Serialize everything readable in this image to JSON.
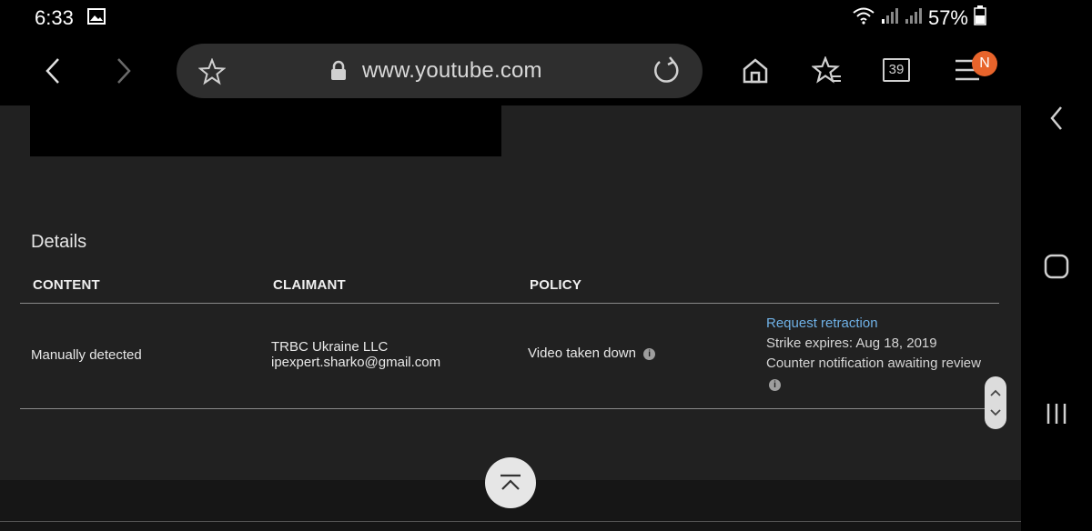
{
  "status_bar": {
    "time": "6:33",
    "battery": "57%"
  },
  "browser": {
    "url": "www.youtube.com",
    "tab_count": "39",
    "notification_badge": "N"
  },
  "details": {
    "heading": "Details",
    "columns": [
      "CONTENT",
      "CLAIMANT",
      "POLICY"
    ],
    "row": {
      "content": "Manually detected",
      "claimant_name": "TRBC Ukraine LLC",
      "claimant_email": "ipexpert.sharko@gmail.com",
      "policy": "Video taken down",
      "action_link": "Request retraction",
      "strike_expires": "Strike expires: Aug 18, 2019",
      "counter_status": "Counter notification awaiting review"
    }
  },
  "colors": {
    "page_bg": "#212121",
    "link": "#6fb1e6",
    "badge": "#e8642b"
  }
}
